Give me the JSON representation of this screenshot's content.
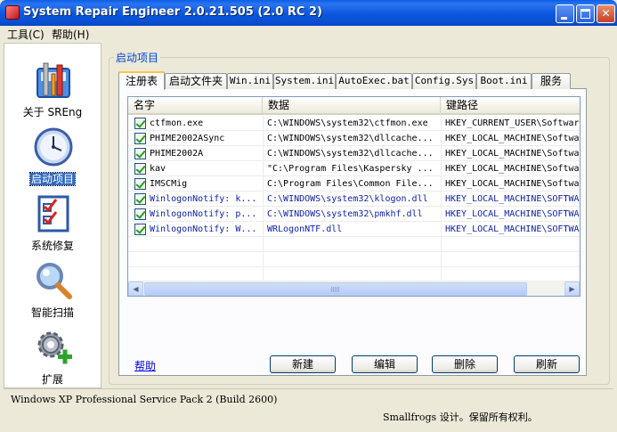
{
  "window": {
    "title": "System Repair Engineer 2.0.21.505 (2.0 RC 2)"
  },
  "menu": [
    {
      "label": "工具(C)"
    },
    {
      "label": "帮助(H)"
    }
  ],
  "nav": [
    {
      "label": "关于 SREng",
      "icon": "toolbox-icon"
    },
    {
      "label": "启动项目",
      "icon": "clock-icon",
      "selected": true
    },
    {
      "label": "系统修复",
      "icon": "checklist-icon"
    },
    {
      "label": "智能扫描",
      "icon": "magnifier-icon"
    },
    {
      "label": "扩展",
      "icon": "gear-plus-icon"
    }
  ],
  "group_title": "启动项目",
  "tabs": [
    {
      "label": "注册表",
      "active": true
    },
    {
      "label": "启动文件夹"
    },
    {
      "label": "Win.ini"
    },
    {
      "label": "System.ini"
    },
    {
      "label": "AutoExec.bat"
    },
    {
      "label": "Config.Sys"
    },
    {
      "label": "Boot.ini"
    },
    {
      "label": "服务"
    }
  ],
  "list": {
    "columns": [
      "名字",
      "数据",
      "键路径"
    ],
    "rows": [
      {
        "name": "ctfmon.exe",
        "data": "C:\\WINDOWS\\system32\\ctfmon.exe",
        "key": "HKEY_CURRENT_USER\\Softwar",
        "checked": true,
        "blue": false
      },
      {
        "name": "PHIME2002ASync",
        "data": "C:\\WINDOWS\\system32\\dllcache...",
        "key": "HKEY_LOCAL_MACHINE\\Softwa",
        "checked": true,
        "blue": false
      },
      {
        "name": "PHIME2002A",
        "data": "C:\\WINDOWS\\system32\\dllcache...",
        "key": "HKEY_LOCAL_MACHINE\\Softwa",
        "checked": true,
        "blue": false
      },
      {
        "name": "kav",
        "data": "\"C:\\Program Files\\Kaspersky ...",
        "key": "HKEY_LOCAL_MACHINE\\Softwa",
        "checked": true,
        "blue": false
      },
      {
        "name": "IMSCMig",
        "data": "C:\\Program Files\\Common File...",
        "key": "HKEY_LOCAL_MACHINE\\Softwa",
        "checked": true,
        "blue": false
      },
      {
        "name": "WinlogonNotify: k...",
        "data": "C:\\WINDOWS\\system32\\klogon.dll",
        "key": "HKEY_LOCAL_MACHINE\\SOFTWA",
        "checked": true,
        "blue": true
      },
      {
        "name": "WinlogonNotify: p...",
        "data": "C:\\WINDOWS\\system32\\pmkhf.dll",
        "key": "HKEY_LOCAL_MACHINE\\SOFTWA",
        "checked": true,
        "blue": true
      },
      {
        "name": "WinlogonNotify: W...",
        "data": "WRLogonNTF.dll",
        "key": "HKEY_LOCAL_MACHINE\\SOFTWA",
        "checked": true,
        "blue": true
      }
    ]
  },
  "actions": {
    "help": "帮助",
    "new": "新建",
    "edit": "编辑",
    "delete": "删除",
    "refresh": "刷新"
  },
  "status": {
    "os": "Windows XP Professional Service Pack 2 (Build 2600)",
    "copyright": "Smallfrogs 设计。保留所有权利。"
  },
  "colors": {
    "title_bar": "#0a56de",
    "selection": "#316ac5",
    "link": "#0000ee",
    "system_entry": "#1022a8"
  }
}
